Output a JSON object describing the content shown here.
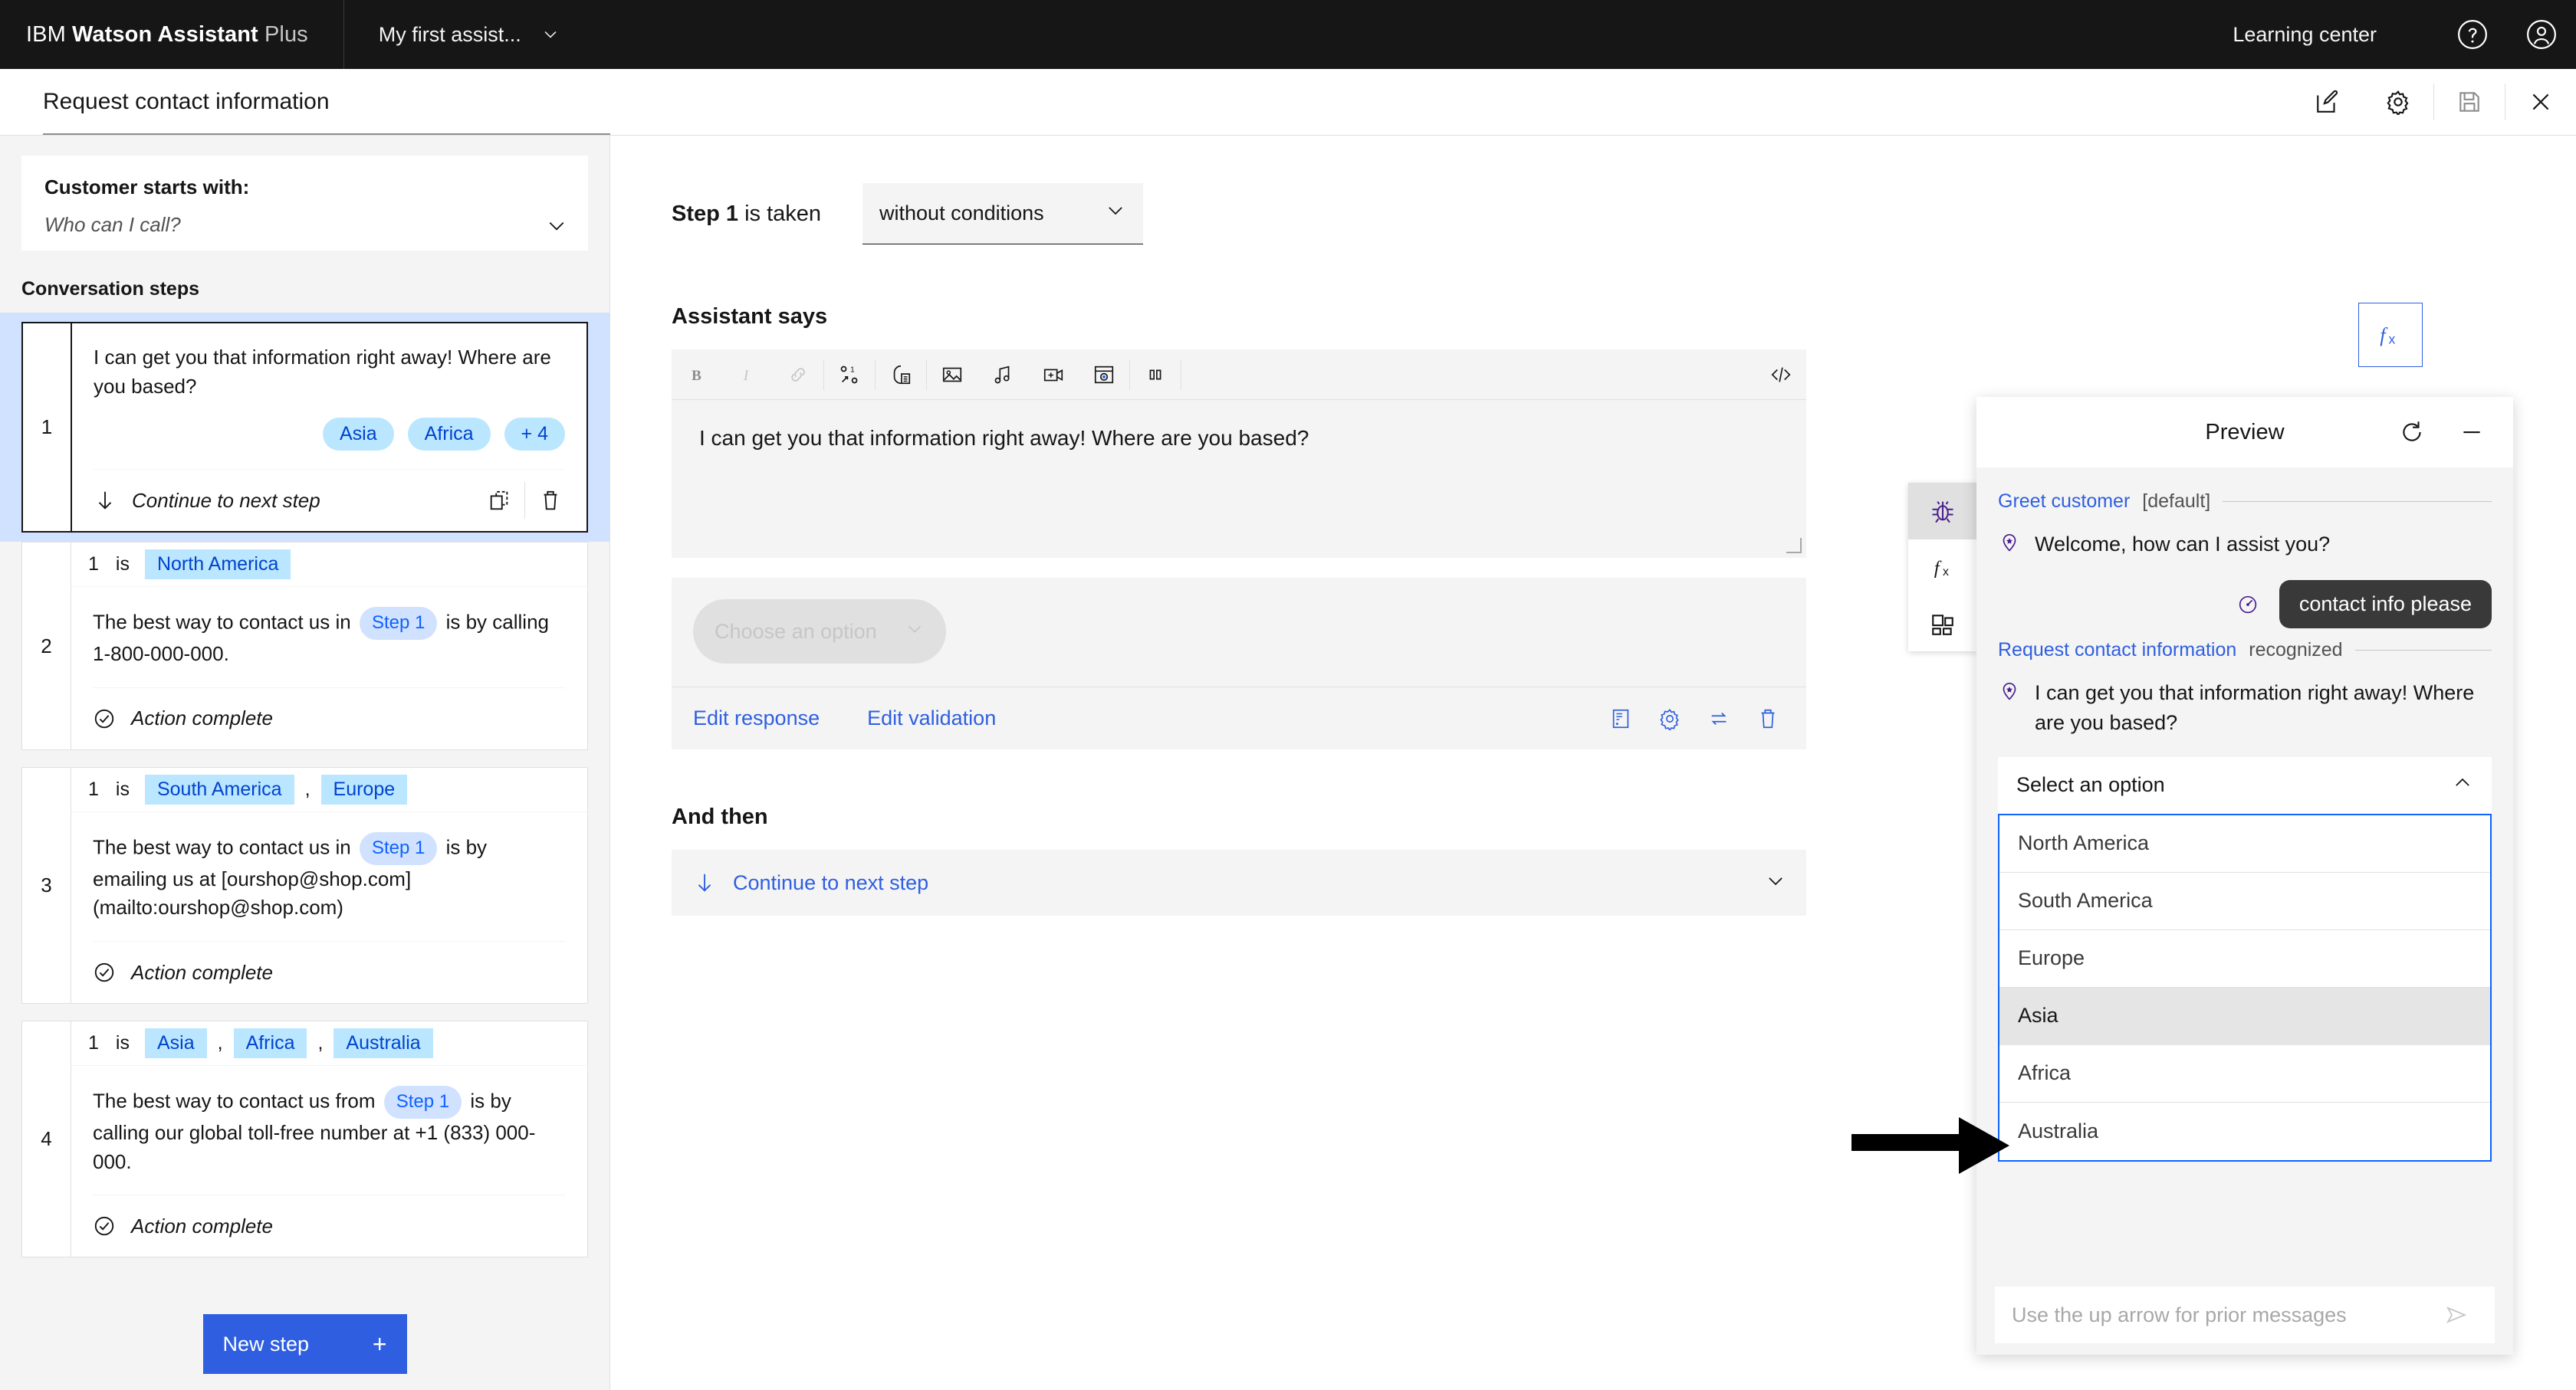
{
  "topbar": {
    "brand_prefix": "IBM",
    "brand_name": "Watson Assistant",
    "brand_plan": "Plus",
    "assistant_name": "My first assist...",
    "learning_center": "Learning center"
  },
  "content_header": {
    "title": "Request contact information"
  },
  "sidebar": {
    "customer_starts_label": "Customer starts with:",
    "customer_starts_value": "Who can I call?",
    "conversation_steps_label": "Conversation steps",
    "new_step_label": "New step",
    "steps": [
      {
        "number": "1",
        "text": "I can get you that information right away! Where are you based?",
        "chips": [
          "Asia",
          "Africa",
          "+ 4"
        ],
        "footer": "Continue to next step"
      },
      {
        "number": "2",
        "cond_num": "1",
        "cond_is": "is",
        "cond_values": [
          "North America"
        ],
        "text_before": "The best way to contact us in",
        "bubble": "Step 1",
        "text_after": "is by calling 1-800-000-000.",
        "footer": "Action complete"
      },
      {
        "number": "3",
        "cond_num": "1",
        "cond_is": "is",
        "cond_values": [
          "South America",
          "Europe"
        ],
        "text_before": "The best way to contact us in",
        "bubble": "Step 1",
        "text_after": "is by emailing us at [ourshop@shop.com](mailto:ourshop@shop.com)",
        "footer": "Action complete"
      },
      {
        "number": "4",
        "cond_num": "1",
        "cond_is": "is",
        "cond_values": [
          "Asia",
          "Africa",
          "Australia"
        ],
        "text_before": "The best way to contact us from",
        "bubble": "Step 1",
        "text_after": "is by calling our global toll-free number at +1 (833) 000-000.",
        "footer": "Action complete"
      }
    ]
  },
  "main": {
    "step_label_bold": "Step 1",
    "step_label_rest": " is taken",
    "condition_select": "without conditions",
    "assistant_says_label": "Assistant says",
    "response_text": "I can get you that information right away! Where are you based?",
    "choose_option_placeholder": "Choose an option",
    "edit_response": "Edit response",
    "edit_validation": "Edit validation",
    "and_then_label": "And then",
    "and_then_value": "Continue to next step"
  },
  "preview": {
    "title": "Preview",
    "nodes": [
      {
        "name": "Greet customer",
        "status": "[default]"
      },
      {
        "name": "Request contact information",
        "status": "recognized"
      }
    ],
    "bot_message_1": "Welcome, how can I assist you?",
    "user_message": "contact info please",
    "bot_message_2": "I can get you that information right away! Where are you based?",
    "select_label": "Select an option",
    "options": [
      "North America",
      "South America",
      "Europe",
      "Asia",
      "Africa",
      "Australia"
    ],
    "highlighted_option": "Asia",
    "input_placeholder": "Use the up arrow for prior messages"
  },
  "colors": {
    "brand_blue": "#0f62fe",
    "button_blue": "#2f5fe0",
    "chip_bg": "#bae6ff",
    "chip_text": "#0043ce",
    "bubble_bg": "#d0e2ff",
    "selected_row": "#d0e2ff",
    "dark_header": "#161616",
    "purple_icon": "#491d8b"
  }
}
